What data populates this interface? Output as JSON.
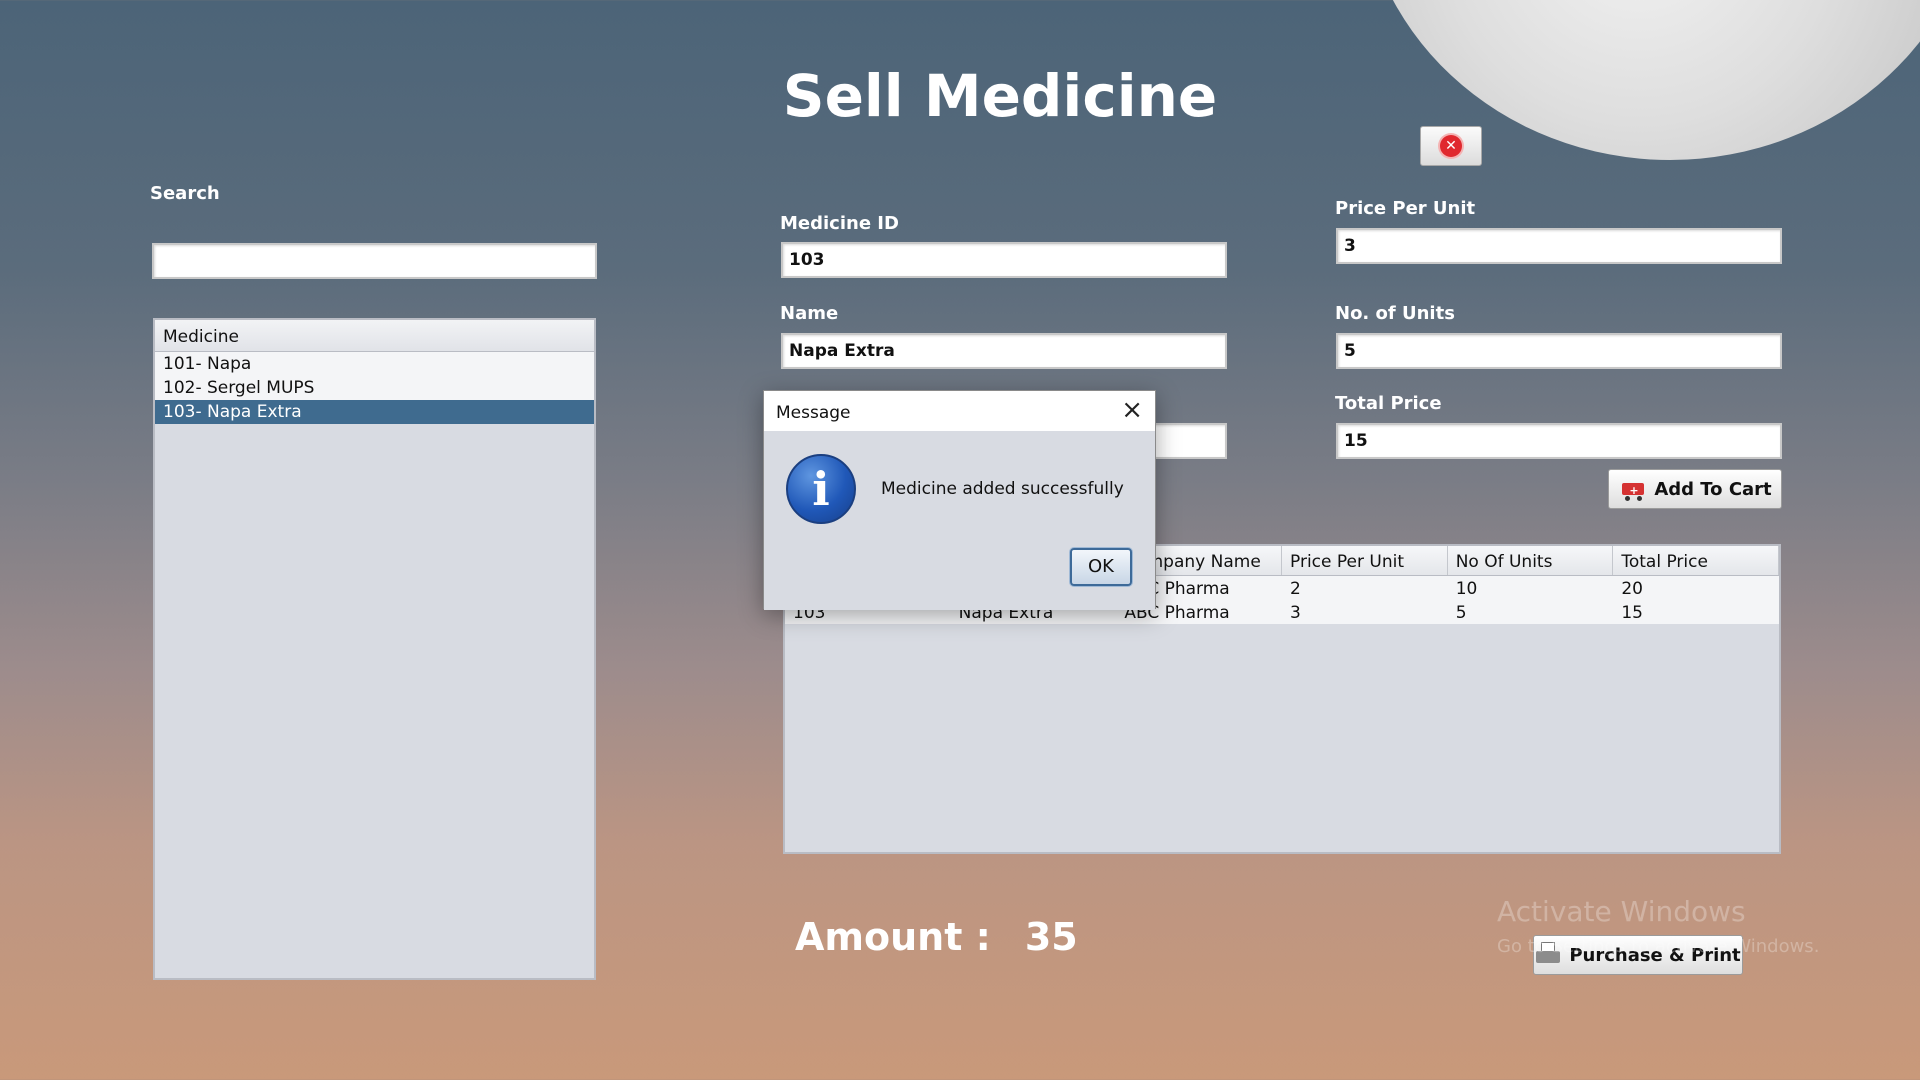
{
  "window": {
    "title": "Sell Medicine"
  },
  "search": {
    "label": "Search",
    "value": ""
  },
  "medicine_list": {
    "header": "Medicine",
    "items": [
      "101- Napa",
      "102- Sergel MUPS",
      "103- Napa Extra"
    ],
    "selected_index": 2
  },
  "form": {
    "medicine_id_label": "Medicine ID",
    "medicine_id_value": "103",
    "name_label": "Name",
    "name_value": "Napa Extra",
    "company_value": "",
    "price_per_unit_label": "Price Per Unit",
    "price_per_unit_value": "3",
    "units_label": "No. of Units",
    "units_value": "5",
    "total_price_label": "Total Price",
    "total_price_value": "15"
  },
  "buttons": {
    "add_to_cart": "Add To Cart",
    "purchase_print": "Purchase & Print"
  },
  "cart_table": {
    "columns": [
      "",
      "",
      "Company Name",
      "Price Per Unit",
      "No Of  Units",
      "Total Price"
    ],
    "rows": [
      [
        "",
        "",
        "ABC Pharma",
        "2",
        "10",
        "20"
      ],
      [
        "103",
        "Napa Extra",
        "ABC Pharma",
        "3",
        "5",
        "15"
      ]
    ]
  },
  "amount": {
    "label": "Amount :",
    "value": "35"
  },
  "dialog": {
    "title": "Message",
    "message": "Medicine added successfully",
    "ok_label": "OK"
  },
  "watermark": {
    "line1": "Activate Windows",
    "line2": "Go to Settings to activate Windows."
  },
  "colors": {
    "selection": "#3f6b8f",
    "panel": "#d8dbe2",
    "close_icon": "#e0282e"
  }
}
